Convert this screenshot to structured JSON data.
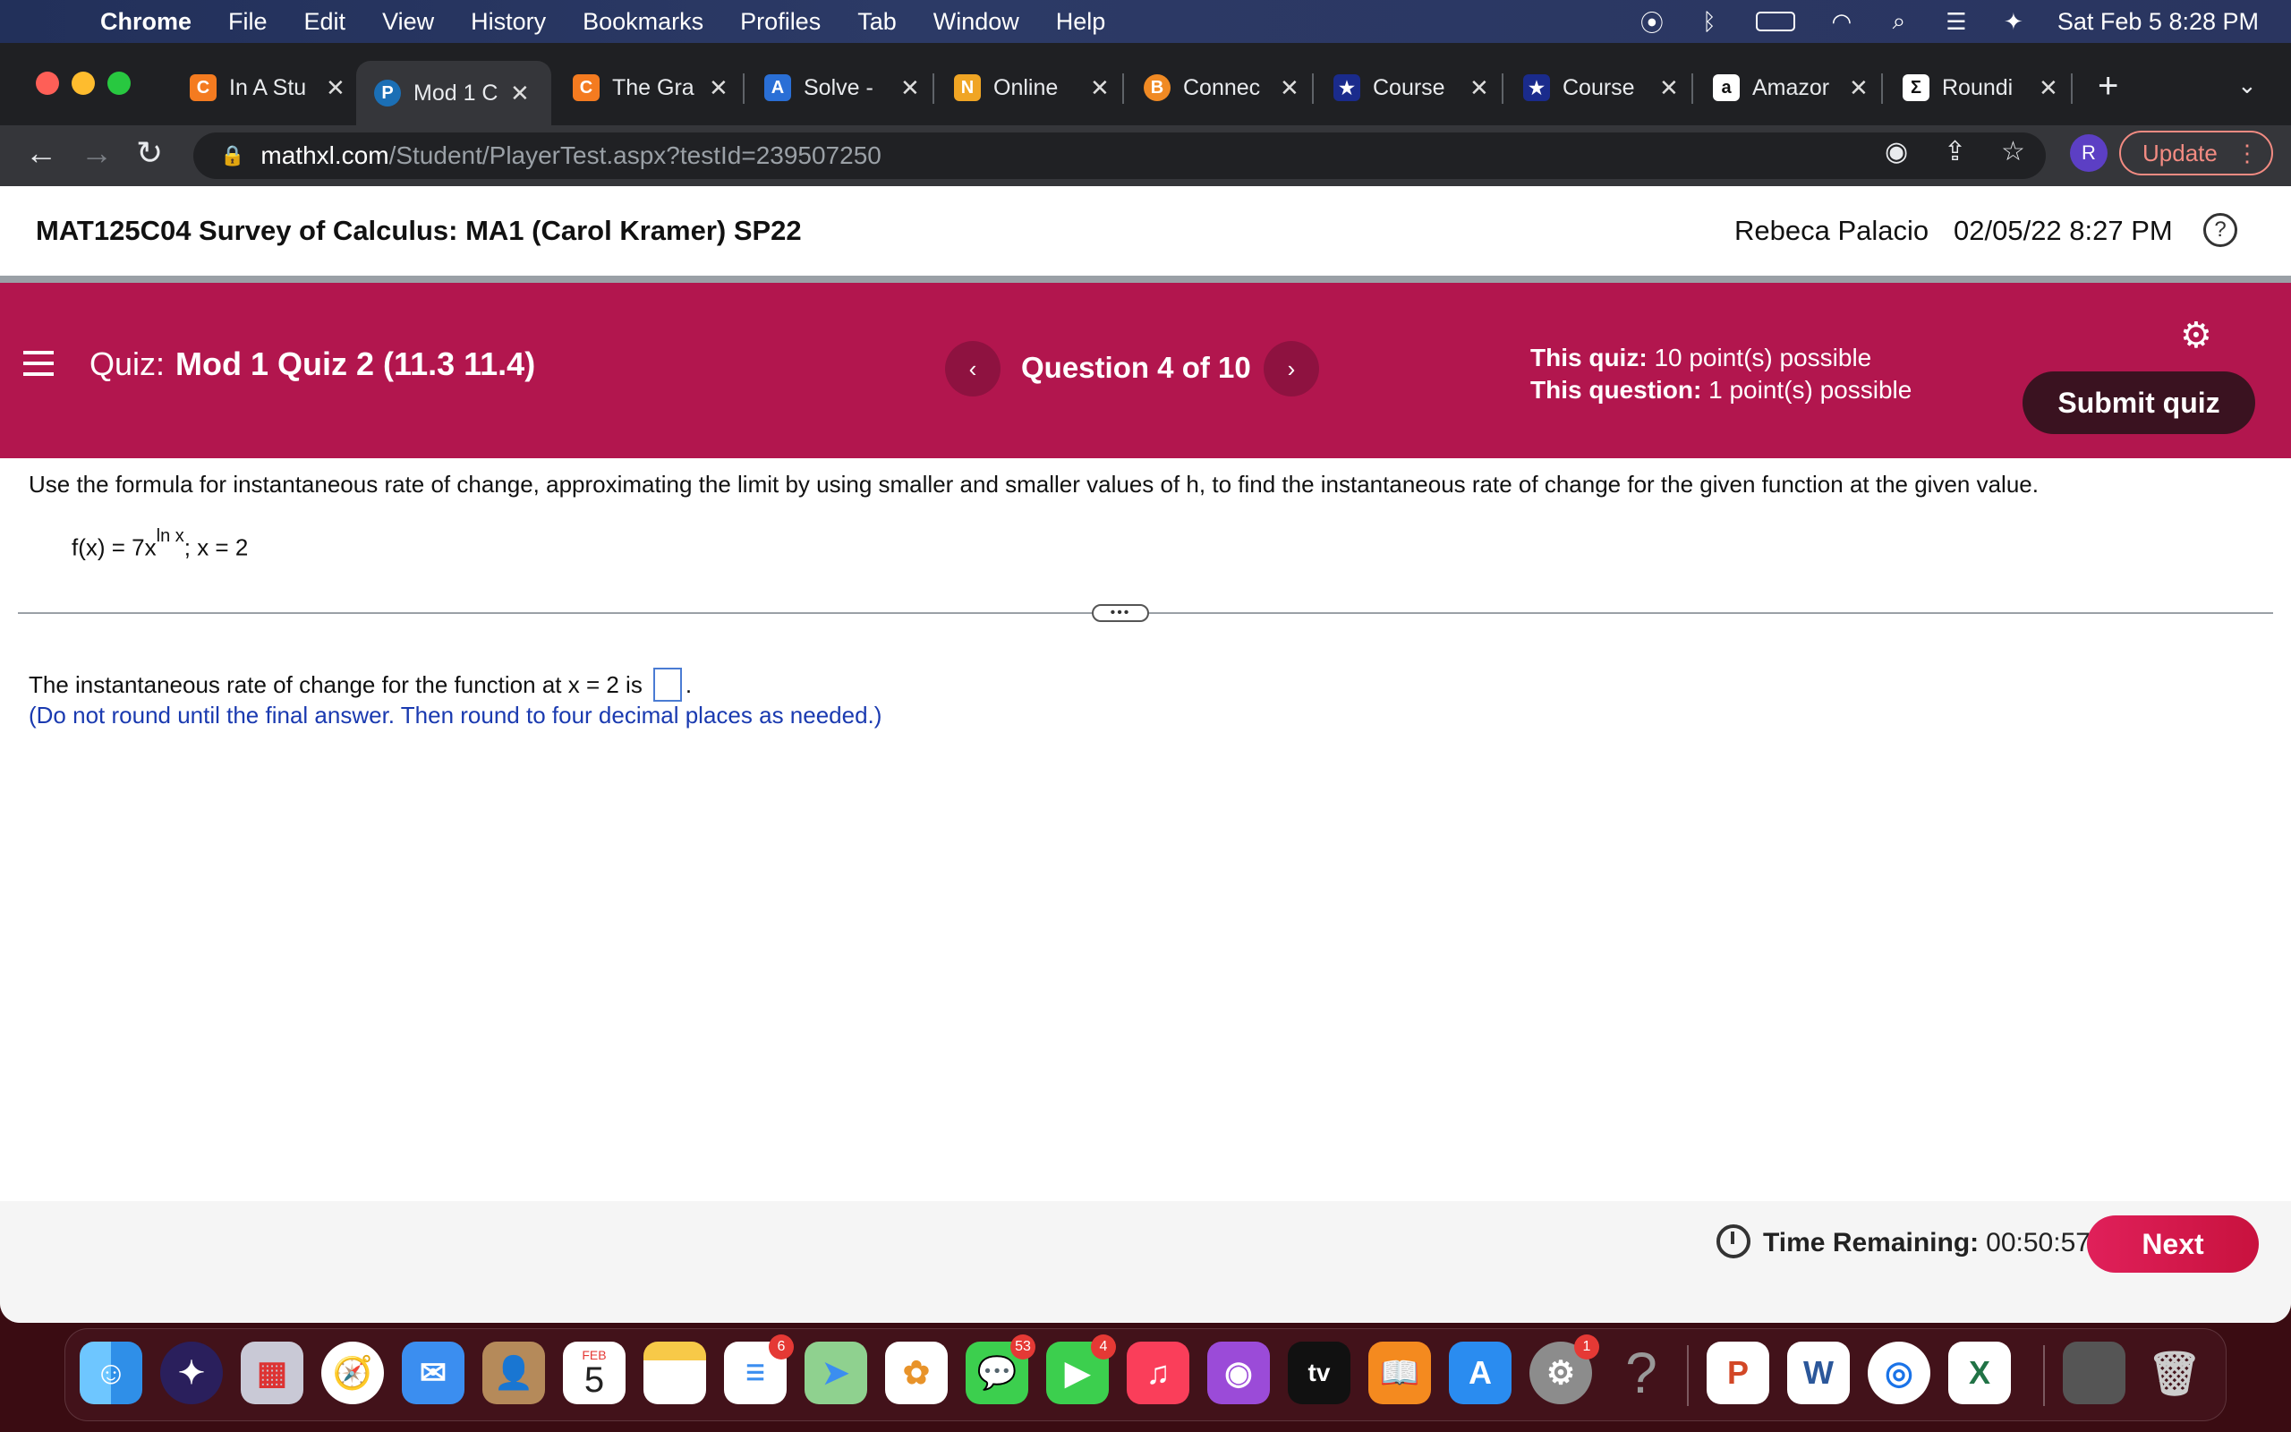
{
  "menubar": {
    "items": [
      "Chrome",
      "File",
      "Edit",
      "View",
      "History",
      "Bookmarks",
      "Profiles",
      "Tab",
      "Window",
      "Help"
    ],
    "datetime": "Sat Feb 5  8:28 PM"
  },
  "browser": {
    "tabs": [
      {
        "label": "In A Stu",
        "favicon": "C",
        "color": "#f47b20"
      },
      {
        "label": "Mod 1 C",
        "favicon": "P",
        "color": "#1b6fb5"
      },
      {
        "label": "The Gra",
        "favicon": "C",
        "color": "#f47b20"
      },
      {
        "label": "Solve -",
        "favicon": "A",
        "color": "#2a6fd6"
      },
      {
        "label": "Online",
        "favicon": "N",
        "color": "#f0a524"
      },
      {
        "label": "Connec",
        "favicon": "B",
        "color": "#f08a24"
      },
      {
        "label": "Course",
        "favicon": "★",
        "color": "#1a2b8c"
      },
      {
        "label": "Course",
        "favicon": "★",
        "color": "#1a2b8c"
      },
      {
        "label": "Amazor",
        "favicon": "a",
        "color": "#ffffff"
      },
      {
        "label": "Roundi",
        "favicon": "Σ",
        "color": "#ffffff"
      }
    ],
    "url_host": "mathxl.com",
    "url_path": "/Student/PlayerTest.aspx?testId=239507250",
    "avatar_initial": "R",
    "update_label": "Update"
  },
  "page": {
    "course_title": "MAT125C04 Survey of Calculus: MA1 (Carol Kramer) SP22",
    "user_name": "Rebeca Palacio",
    "datetime": "02/05/22 8:27 PM",
    "help_symbol": "?"
  },
  "quizbar": {
    "quiz_prefix": "Quiz:",
    "quiz_name": "Mod 1 Quiz 2 (11.3 11.4)",
    "question_counter": "Question 4 of 10",
    "quiz_points_label": "This quiz:",
    "quiz_points_value": "10 point(s) possible",
    "question_points_label": "This question:",
    "question_points_value": "1 point(s) possible",
    "submit_label": "Submit quiz"
  },
  "question": {
    "instructions": "Use the formula for instantaneous rate of change, approximating the limit by using smaller and smaller values of h, to find the instantaneous rate of change for the given function at the given value.",
    "formula_base": "f(x) = 7x",
    "formula_exponent": "ln x",
    "formula_tail": ";  x = 2",
    "answer_prefix": "The instantaneous rate of change for the function at x = 2 is",
    "answer_suffix": ".",
    "round_note": "(Do not round until the final answer. Then round to four decimal places as needed.)"
  },
  "footer": {
    "time_label": "Time Remaining:",
    "time_value": "00:50:57",
    "next_label": "Next"
  },
  "dock": {
    "calendar_month": "FEB",
    "calendar_day": "5",
    "badges": {
      "reminders": "6",
      "messages": "53",
      "facetime": "4",
      "settings": "1"
    }
  }
}
